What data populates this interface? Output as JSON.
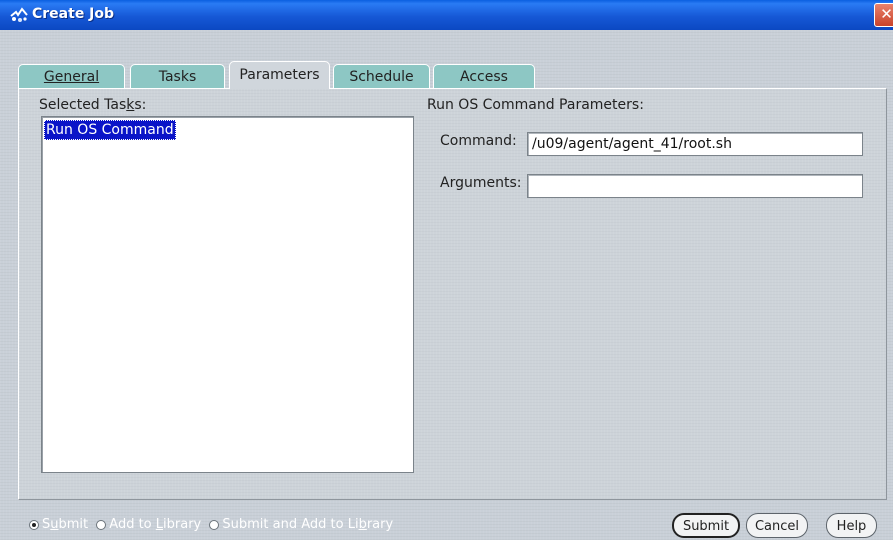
{
  "window": {
    "title": "Create Job",
    "close_glyph": "✕"
  },
  "tabs": [
    {
      "label": "General",
      "mnemonic_index": 0
    },
    {
      "label": "Tasks",
      "mnemonic_index": 0
    },
    {
      "label": "Parameters",
      "mnemonic_index": 0,
      "active": true
    },
    {
      "label": "Schedule",
      "mnemonic_index": 0
    },
    {
      "label": "Access",
      "mnemonic_index": 1
    }
  ],
  "parameters_panel": {
    "selected_tasks_label_pre": "Selected Tas",
    "selected_tasks_label_mn": "k",
    "selected_tasks_label_post": "s:",
    "selected_tasks": [
      "Run OS Command"
    ],
    "section_title": "Run OS Command Parameters:",
    "command_label": "Command:",
    "command_value": "/u09/agent/agent_41/root.sh",
    "arguments_label": "Arguments:",
    "arguments_value": ""
  },
  "footer": {
    "radios": [
      {
        "pre": "S",
        "mn": "u",
        "post": "bmit",
        "checked": true
      },
      {
        "pre": "Add to ",
        "mn": "L",
        "post": "ibrary",
        "checked": false
      },
      {
        "pre": "Submit and Add to Li",
        "mn": "b",
        "post": "rary",
        "checked": false
      }
    ],
    "submit_label": "Submit",
    "cancel_label": "Cancel",
    "help_label": "Help"
  },
  "colors": {
    "titlebar": "#1658d6",
    "tab_inactive": "#8dc7c4",
    "selection": "#0a14c8"
  }
}
